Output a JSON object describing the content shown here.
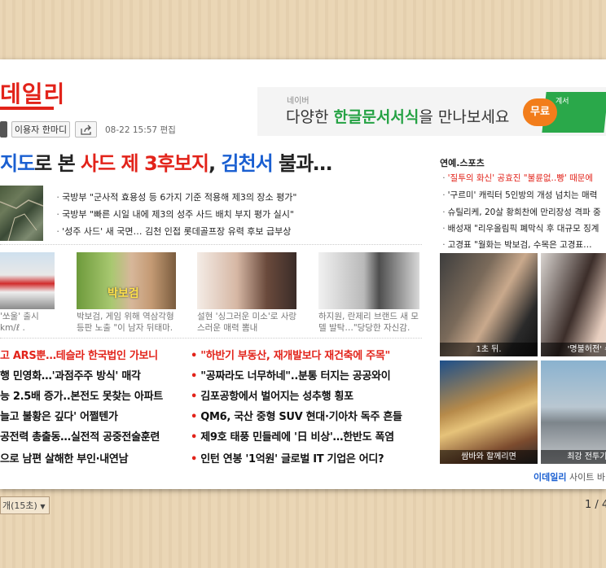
{
  "header": {
    "logo": "데일리",
    "feedback_button": "이용자 한마디",
    "timestamp": "08-22 15:57 편집"
  },
  "ad": {
    "brand": "네이버",
    "text_pre": "다양한 ",
    "text_highlight": "한글문서서식",
    "text_post": "을 만나보세요",
    "badge": "무료",
    "doc_label": "계서"
  },
  "headline": {
    "part1": "지도",
    "part2": "로 본 ",
    "part3": "사드 제 3후보지",
    "part4": ", ",
    "part5": "김천서",
    "part6": " 불과…"
  },
  "sub_news": [
    "국방부 \"군사적 효용성 등 6가지 기준 적용해 제3의 장소 평가\"",
    "국방부 \"빠른 시일 내에 제3의 성주 사드 배치 부지 평가 실시\"",
    "'성주 사드' 새 국면… 김천 인접 롯데골프장 유력 후보 급부상"
  ],
  "photos": [
    {
      "line1": "'쏘울' 출시",
      "line2": "km/ℓ ."
    },
    {
      "line1": "박보검, 게임 위해 역삼각형",
      "line2": "등판 노출 \"이 남자 뒤태마."
    },
    {
      "line1": "설현 '싱그러운 미소'로 사랑",
      "line2": "스러운 매력 뽐내"
    },
    {
      "line1": "하지원, 란제리 브랜드 새 모",
      "line2": "델 발탁…\"당당한 자신감."
    }
  ],
  "thumb2_overlay": "박보검",
  "left_news": [
    "고 ARS뿐…테슬라 한국법인 가보니",
    "행 민영화…'과점주주 방식' 매각",
    "능 2.5배 증가..본전도 못찾는 아파트",
    "늘고 불황은 깊다' 어쩔텐가",
    "공전력 총출동…실전적 공중전술훈련",
    "으로 남편 살해한 부인·내연남"
  ],
  "right_news": [
    "\"하반기 부동산, 재개발보다 재건축에 주목\"",
    "\"공짜라도 너무하네\"..분통 터지는 공공와이",
    "김포공항에서 벌어지는 성추행 횡포",
    "QM6, 국산 중형 SUV 현대·기아차 독주 흔들",
    "제9호 태풍 민들레에 '日 비상'…한반도 폭염",
    "인턴 연봉 '1억원' 글로벌 IT 기업은 어디?"
  ],
  "sidebar": {
    "title": "연예.스포츠",
    "items": [
      "'질투의 화신' 공효진 \"불륜없..빵' 때문에",
      "'구르미' 캐릭터 5인방의 개성 넘치는 매력",
      "슈틸리케, 20살 황희찬에 만리장성 격파 중",
      "배성재 \"리우올림픽 폐막식 후 대규모 징계",
      "고경표 \"월화는 박보검, 수목은 고경표…"
    ],
    "photos": [
      "1초 뒤.",
      "'명불허전' 수",
      "쌈바와 할께리면",
      "최강 전투기 ·"
    ],
    "footer_brand": "이데일리",
    "footer_text": " 사이트 바"
  },
  "footer": {
    "select": "개(15초)",
    "page": "1 / 4"
  }
}
